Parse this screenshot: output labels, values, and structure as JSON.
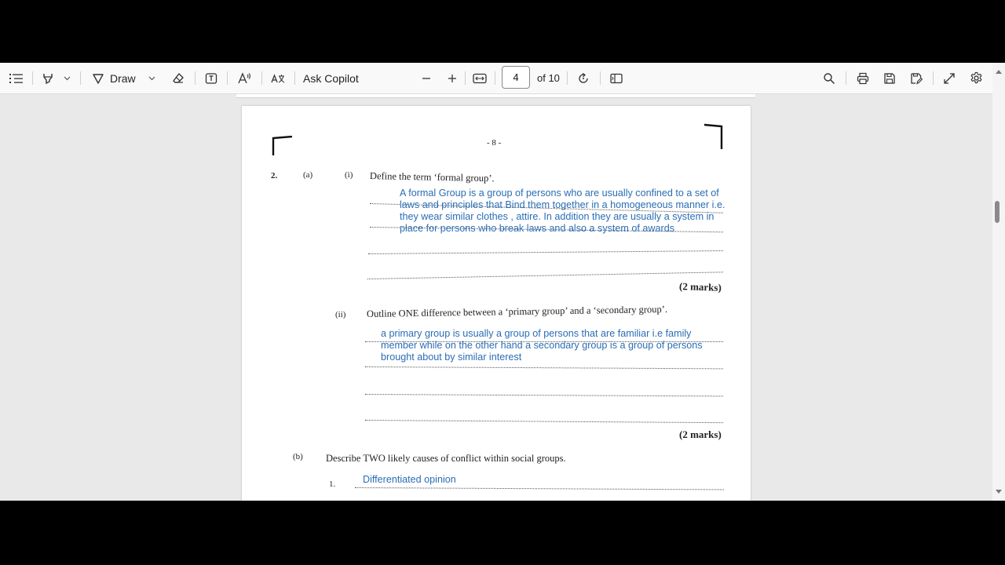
{
  "toolbar": {
    "draw_label": "Draw",
    "ask_copilot_label": "Ask Copilot",
    "page_number": "4",
    "page_total_label": "of 10",
    "icons": [
      "contents-icon",
      "highlight-icon",
      "draw-icon",
      "eraser-icon",
      "textbox-icon",
      "read-aloud-icon",
      "translate-icon",
      "zoom-out-icon",
      "zoom-in-icon",
      "fit-width-icon",
      "rotate-icon",
      "page-view-icon",
      "search-icon",
      "print-icon",
      "save-icon",
      "save-as-icon",
      "fullscreen-icon",
      "settings-icon"
    ]
  },
  "document": {
    "page_label": "- 8 -",
    "q2_number": "2.",
    "part_a_label": "(a)",
    "sub_i_label": "(i)",
    "q_a_i_text": "Define the term ‘formal group’.",
    "q_a_i_answer": [
      "A formal Group is a group of persons who are usually confined to a set of",
      "laws and principles that Bind them together in a homogeneous manner i.e.",
      "they wear similar clothes  , attire. In addition they are usually a system in",
      "place for persons who break laws and also a system of awards"
    ],
    "marks_1": "(2 marks)",
    "sub_ii_label": "(ii)",
    "q_a_ii_text": "Outline ONE difference between a ‘primary group’ and a ‘secondary group’.",
    "q_a_ii_answer": [
      "a primary group is usually a group of persons that are familiar i.e family",
      "member while on the other hand a secondary group is a group of persons",
      "brought about by similar interest"
    ],
    "marks_2": "(2 marks)",
    "part_b_label": "(b)",
    "q_b_text": "Describe TWO likely causes of conflict within social groups.",
    "item_1_label": "1.",
    "item_1_answer": "Differentiated opinion"
  },
  "colors": {
    "answer_ink": "#2a6db5",
    "toolbar_bg": "#f9f9f9",
    "viewer_bg": "#e9e9e9"
  }
}
